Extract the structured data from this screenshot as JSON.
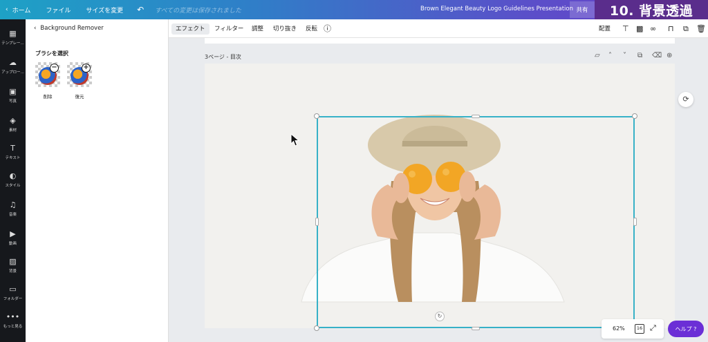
{
  "topbar": {
    "home_label": "ホーム",
    "file_label": "ファイル",
    "resize_label": "サイズを変更",
    "undo_icon": "undo-icon",
    "saved_status": "すべての変更は保存されました",
    "doc_title": "Brown Elegant Beauty Logo Guidelines Presentation",
    "share_label": "共有"
  },
  "overlay_title": "10. 背景透過",
  "rail": {
    "items": [
      {
        "label": "テンプレー...",
        "icon": "template-icon"
      },
      {
        "label": "アップロー...",
        "icon": "upload-icon"
      },
      {
        "label": "写真",
        "icon": "photo-icon"
      },
      {
        "label": "素材",
        "icon": "elements-icon"
      },
      {
        "label": "テキスト",
        "icon": "text-icon"
      },
      {
        "label": "スタイル",
        "icon": "style-icon"
      },
      {
        "label": "音楽",
        "icon": "music-icon"
      },
      {
        "label": "動画",
        "icon": "video-icon"
      },
      {
        "label": "背景",
        "icon": "background-icon"
      },
      {
        "label": "フォルダー",
        "icon": "folder-icon"
      },
      {
        "label": "もっと見る",
        "icon": "more-icon"
      }
    ]
  },
  "panel": {
    "back_label": "Background Remover",
    "brush_heading": "ブラシを選択",
    "brushes": [
      {
        "label": "削除",
        "badge": "−"
      },
      {
        "label": "復元",
        "badge": "+"
      }
    ]
  },
  "toolbar": {
    "effects": "エフェクト",
    "filter": "フィルター",
    "adjust": "調整",
    "crop": "切り抜き",
    "flip": "反転",
    "info_icon": "info-icon",
    "position": "配置"
  },
  "canvas": {
    "page_label": "3ページ - 目次"
  },
  "bottom": {
    "zoom": "62%",
    "page_count": "16",
    "help_label": "ヘルプ ?"
  }
}
